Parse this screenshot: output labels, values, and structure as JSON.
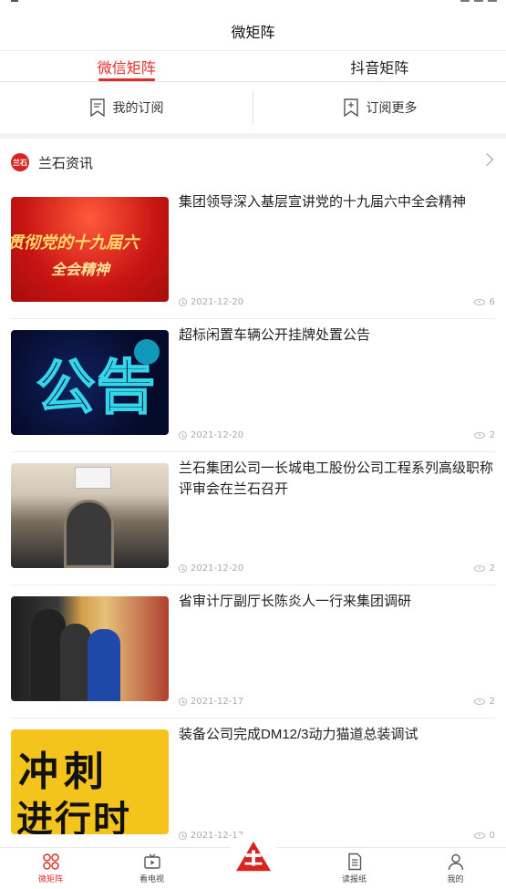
{
  "header": {
    "title": "微矩阵"
  },
  "tabs": [
    {
      "label": "微信矩阵",
      "active": true
    },
    {
      "label": "抖音矩阵",
      "active": false
    }
  ],
  "subbar": {
    "my_subscription": "我的订阅",
    "subscribe_more": "订阅更多"
  },
  "section": {
    "title": "兰石资讯",
    "logo_text": "兰石"
  },
  "news": [
    {
      "title": "集团领导深入基层宣讲党的十九届六中全会精神",
      "date": "2021-12-20",
      "views": "6",
      "thumb_line1": "贯彻党的十九届六",
      "thumb_line2": "全会精神"
    },
    {
      "title": "超标闲置车辆公开挂牌处置公告",
      "date": "2021-12-20",
      "views": "2",
      "thumb_text": "公告"
    },
    {
      "title": "兰石集团公司一长城电工股份公司工程系列高级职称评审会在兰石召开",
      "date": "2021-12-20",
      "views": "2"
    },
    {
      "title": "省审计厅副厅长陈炎人一行来集团调研",
      "date": "2021-12-17",
      "views": "2"
    },
    {
      "title": "装备公司完成DM12/3动力猫道总装调试",
      "date": "2021-12-17",
      "views": "0",
      "thumb_line1": "冲刺",
      "thumb_line2": "进行时"
    }
  ],
  "bottom_nav": [
    {
      "label": "微矩阵",
      "icon": "grid-icon",
      "active": true
    },
    {
      "label": "看电视",
      "icon": "tv-icon",
      "active": false
    },
    {
      "label": "",
      "icon": "brand-logo-icon",
      "active": false
    },
    {
      "label": "读报纸",
      "icon": "newspaper-icon",
      "active": false
    },
    {
      "label": "我的",
      "icon": "user-icon",
      "active": false
    }
  ],
  "colors": {
    "accent": "#e22c29"
  }
}
